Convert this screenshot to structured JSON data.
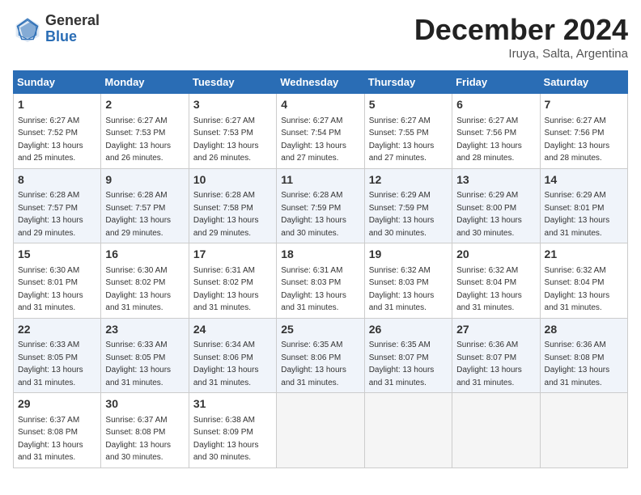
{
  "header": {
    "logo_general": "General",
    "logo_blue": "Blue",
    "month_title": "December 2024",
    "location": "Iruya, Salta, Argentina"
  },
  "calendar": {
    "days_of_week": [
      "Sunday",
      "Monday",
      "Tuesday",
      "Wednesday",
      "Thursday",
      "Friday",
      "Saturday"
    ],
    "weeks": [
      [
        {
          "num": "1",
          "sunrise": "6:27 AM",
          "sunset": "7:52 PM",
          "daylight": "13 hours and 25 minutes."
        },
        {
          "num": "2",
          "sunrise": "6:27 AM",
          "sunset": "7:53 PM",
          "daylight": "13 hours and 26 minutes."
        },
        {
          "num": "3",
          "sunrise": "6:27 AM",
          "sunset": "7:53 PM",
          "daylight": "13 hours and 26 minutes."
        },
        {
          "num": "4",
          "sunrise": "6:27 AM",
          "sunset": "7:54 PM",
          "daylight": "13 hours and 27 minutes."
        },
        {
          "num": "5",
          "sunrise": "6:27 AM",
          "sunset": "7:55 PM",
          "daylight": "13 hours and 27 minutes."
        },
        {
          "num": "6",
          "sunrise": "6:27 AM",
          "sunset": "7:56 PM",
          "daylight": "13 hours and 28 minutes."
        },
        {
          "num": "7",
          "sunrise": "6:27 AM",
          "sunset": "7:56 PM",
          "daylight": "13 hours and 28 minutes."
        }
      ],
      [
        {
          "num": "8",
          "sunrise": "6:28 AM",
          "sunset": "7:57 PM",
          "daylight": "13 hours and 29 minutes."
        },
        {
          "num": "9",
          "sunrise": "6:28 AM",
          "sunset": "7:57 PM",
          "daylight": "13 hours and 29 minutes."
        },
        {
          "num": "10",
          "sunrise": "6:28 AM",
          "sunset": "7:58 PM",
          "daylight": "13 hours and 29 minutes."
        },
        {
          "num": "11",
          "sunrise": "6:28 AM",
          "sunset": "7:59 PM",
          "daylight": "13 hours and 30 minutes."
        },
        {
          "num": "12",
          "sunrise": "6:29 AM",
          "sunset": "7:59 PM",
          "daylight": "13 hours and 30 minutes."
        },
        {
          "num": "13",
          "sunrise": "6:29 AM",
          "sunset": "8:00 PM",
          "daylight": "13 hours and 30 minutes."
        },
        {
          "num": "14",
          "sunrise": "6:29 AM",
          "sunset": "8:01 PM",
          "daylight": "13 hours and 31 minutes."
        }
      ],
      [
        {
          "num": "15",
          "sunrise": "6:30 AM",
          "sunset": "8:01 PM",
          "daylight": "13 hours and 31 minutes."
        },
        {
          "num": "16",
          "sunrise": "6:30 AM",
          "sunset": "8:02 PM",
          "daylight": "13 hours and 31 minutes."
        },
        {
          "num": "17",
          "sunrise": "6:31 AM",
          "sunset": "8:02 PM",
          "daylight": "13 hours and 31 minutes."
        },
        {
          "num": "18",
          "sunrise": "6:31 AM",
          "sunset": "8:03 PM",
          "daylight": "13 hours and 31 minutes."
        },
        {
          "num": "19",
          "sunrise": "6:32 AM",
          "sunset": "8:03 PM",
          "daylight": "13 hours and 31 minutes."
        },
        {
          "num": "20",
          "sunrise": "6:32 AM",
          "sunset": "8:04 PM",
          "daylight": "13 hours and 31 minutes."
        },
        {
          "num": "21",
          "sunrise": "6:32 AM",
          "sunset": "8:04 PM",
          "daylight": "13 hours and 31 minutes."
        }
      ],
      [
        {
          "num": "22",
          "sunrise": "6:33 AM",
          "sunset": "8:05 PM",
          "daylight": "13 hours and 31 minutes."
        },
        {
          "num": "23",
          "sunrise": "6:33 AM",
          "sunset": "8:05 PM",
          "daylight": "13 hours and 31 minutes."
        },
        {
          "num": "24",
          "sunrise": "6:34 AM",
          "sunset": "8:06 PM",
          "daylight": "13 hours and 31 minutes."
        },
        {
          "num": "25",
          "sunrise": "6:35 AM",
          "sunset": "8:06 PM",
          "daylight": "13 hours and 31 minutes."
        },
        {
          "num": "26",
          "sunrise": "6:35 AM",
          "sunset": "8:07 PM",
          "daylight": "13 hours and 31 minutes."
        },
        {
          "num": "27",
          "sunrise": "6:36 AM",
          "sunset": "8:07 PM",
          "daylight": "13 hours and 31 minutes."
        },
        {
          "num": "28",
          "sunrise": "6:36 AM",
          "sunset": "8:08 PM",
          "daylight": "13 hours and 31 minutes."
        }
      ],
      [
        {
          "num": "29",
          "sunrise": "6:37 AM",
          "sunset": "8:08 PM",
          "daylight": "13 hours and 31 minutes."
        },
        {
          "num": "30",
          "sunrise": "6:37 AM",
          "sunset": "8:08 PM",
          "daylight": "13 hours and 30 minutes."
        },
        {
          "num": "31",
          "sunrise": "6:38 AM",
          "sunset": "8:09 PM",
          "daylight": "13 hours and 30 minutes."
        },
        null,
        null,
        null,
        null
      ]
    ]
  }
}
